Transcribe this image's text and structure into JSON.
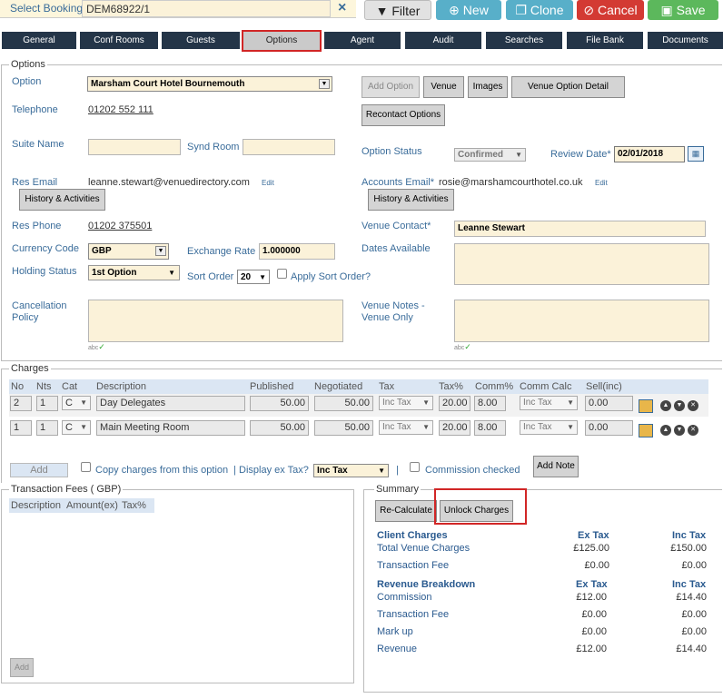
{
  "toolbar": {
    "select_booking_label": "Select Booking",
    "booking_value": "DEM68922/1",
    "clear_icon": "×",
    "filter": "Filter",
    "new": "New",
    "clone": "Clone",
    "cancel": "Cancel",
    "save": "Save"
  },
  "tabs": [
    "General",
    "Conf Rooms",
    "Guests",
    "Options",
    "Agent",
    "Audit",
    "Searches",
    "File Bank",
    "Documents"
  ],
  "options": {
    "legend": "Options",
    "option_label": "Option",
    "option_value": "Marsham Court Hotel Bournemouth",
    "telephone_label": "Telephone",
    "telephone_value": "01202 552 111",
    "add_option": "Add Option",
    "venue": "Venue",
    "images": "Images",
    "venue_option_detail": "Venue Option Detail",
    "recontact_options": "Recontact Options",
    "suite_name_label": "Suite Name",
    "synd_room_label": "Synd Room",
    "option_status_label": "Option Status",
    "option_status_value": "Confirmed",
    "review_date_label": "Review Date*",
    "review_date_value": "02/01/2018",
    "res_email_label": "Res Email",
    "res_email_value": "leanne.stewart@venuedirectory.com",
    "edit1": "Edit",
    "accounts_email_label": "Accounts Email*",
    "accounts_email_value": "rosie@marshamcourthotel.co.uk",
    "edit2": "Edit",
    "history_activities": "History & Activities",
    "res_phone_label": "Res Phone",
    "res_phone_value": "01202 375501",
    "venue_contact_label": "Venue Contact*",
    "venue_contact_value": "Leanne Stewart",
    "currency_code_label": "Currency Code",
    "currency_code_value": "GBP",
    "exchange_rate_label": "Exchange Rate",
    "exchange_rate_value": "1.000000",
    "dates_available_label": "Dates Available",
    "holding_status_label": "Holding Status",
    "holding_status_value": "1st Option",
    "sort_order_label": "Sort Order",
    "sort_order_value": "20",
    "apply_sort_order": "Apply Sort Order?",
    "cancellation_policy_label": "Cancellation Policy",
    "venue_notes_label": "Venue Notes - Venue Only",
    "spell_icon": "abc"
  },
  "charges": {
    "legend": "Charges",
    "headers": [
      "No",
      "Nts",
      "Cat",
      "Description",
      "Published",
      "Negotiated",
      "Tax",
      "Tax%",
      "Comm%",
      "Comm Calc",
      "Sell(inc)"
    ],
    "rows": [
      {
        "no": "2",
        "nts": "1",
        "cat": "C",
        "description": "Day Delegates",
        "published": "50.00",
        "negotiated": "50.00",
        "tax": "Inc Tax",
        "tax_pct": "20.00",
        "comm_pct": "8.00",
        "comm_calc": "Inc Tax",
        "sell": "0.00"
      },
      {
        "no": "1",
        "nts": "1",
        "cat": "C",
        "description": "Main Meeting Room",
        "published": "50.00",
        "negotiated": "50.00",
        "tax": "Inc Tax",
        "tax_pct": "20.00",
        "comm_pct": "8.00",
        "comm_calc": "Inc Tax",
        "sell": "0.00"
      }
    ],
    "add": "Add",
    "copy_charges": "Copy charges from this option",
    "separator": "|",
    "display_ex_tax": "Display ex Tax?",
    "display_ex_tax_value": "Inc Tax",
    "separator2": "|",
    "commission_checked": "Commission checked",
    "add_note": "Add Note"
  },
  "transaction_fees": {
    "legend": "Transaction Fees ( GBP)",
    "headers": [
      "Description",
      "Amount(ex)",
      "Tax%"
    ],
    "add": "Add"
  },
  "summary": {
    "legend": "Summary",
    "recalculate": "Re-Calculate",
    "unlock_charges": "Unlock Charges",
    "client_charges": "Client Charges",
    "ex_tax": "Ex Tax",
    "inc_tax": "Inc Tax",
    "rows1": [
      {
        "label": "Total Venue Charges",
        "ex": "£125.00",
        "inc": "£150.00"
      },
      {
        "label": "Transaction Fee",
        "ex": "£0.00",
        "inc": "£0.00"
      }
    ],
    "revenue_breakdown": "Revenue Breakdown",
    "rows2": [
      {
        "label": "Commission",
        "ex": "£12.00",
        "inc": "£14.40"
      },
      {
        "label": "Transaction Fee",
        "ex": "£0.00",
        "inc": "£0.00"
      },
      {
        "label": "Mark up",
        "ex": "£0.00",
        "inc": "£0.00"
      },
      {
        "label": "Revenue",
        "ex": "£12.00",
        "inc": "£14.40"
      }
    ]
  }
}
